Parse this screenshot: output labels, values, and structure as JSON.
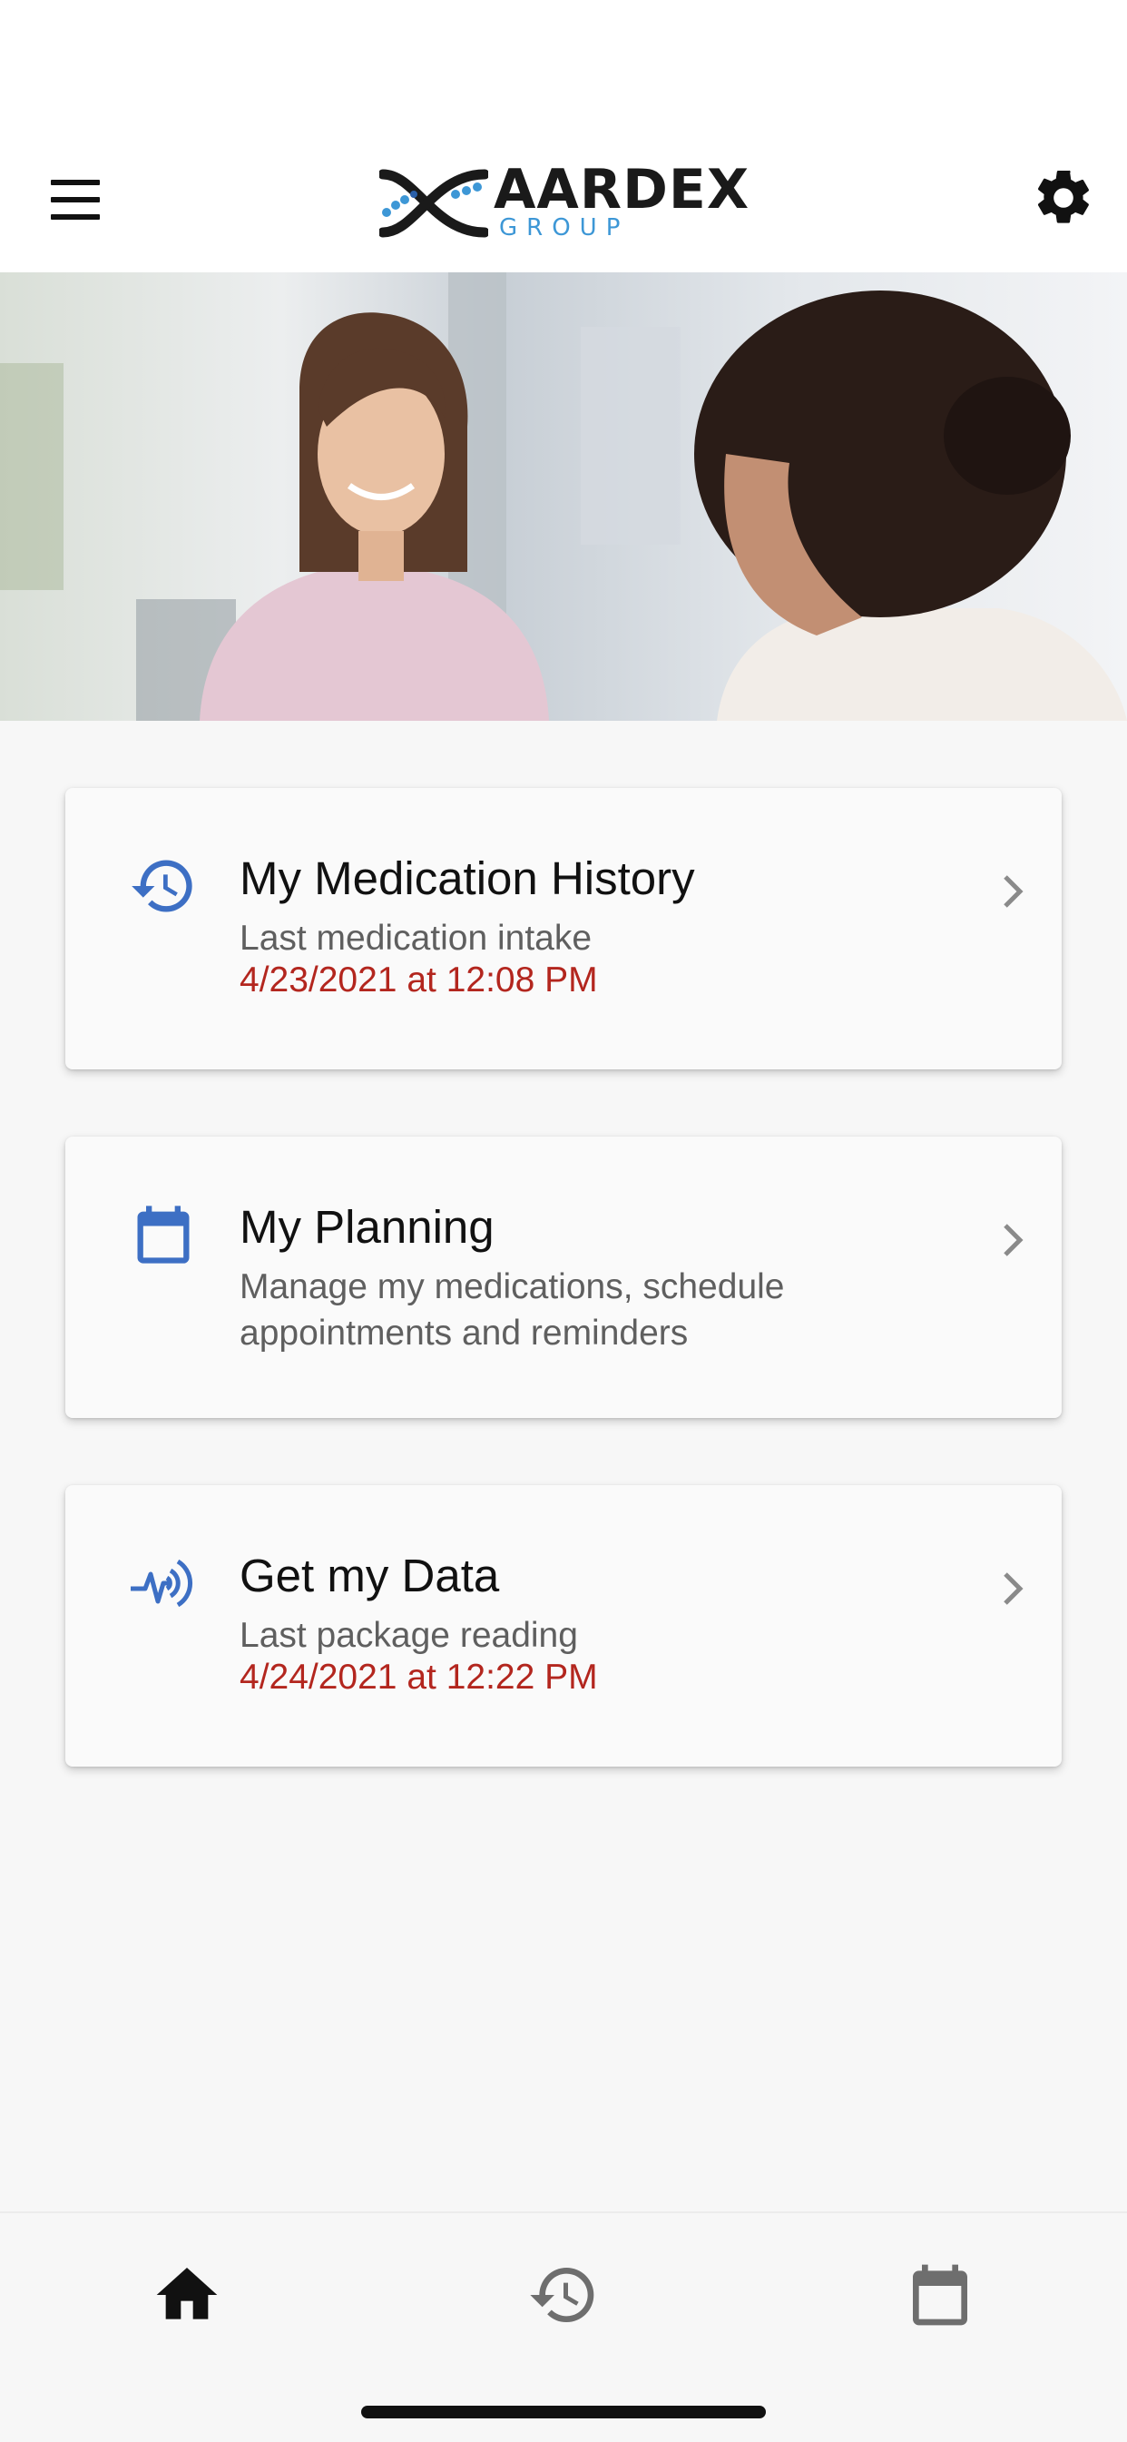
{
  "header": {
    "brand_name": "AARDEX",
    "brand_sub": "GROUP",
    "menu_icon": "hamburger-menu-icon",
    "settings_icon": "gear-icon"
  },
  "hero": {
    "image": "doctor-patient-consultation-photo"
  },
  "cards": [
    {
      "icon": "history-icon",
      "title": "My Medication History",
      "subtitle": "Last medication intake",
      "date": "4/23/2021 at 12:08 PM"
    },
    {
      "icon": "calendar-icon",
      "title": "My Planning",
      "subtitle": "Manage my medications, schedule appointments and reminders"
    },
    {
      "icon": "data-reading-icon",
      "title": "Get my Data",
      "subtitle": "Last package reading",
      "date": "4/24/2021 at 12:22 PM"
    }
  ],
  "bottom_nav": [
    {
      "icon": "home-icon",
      "selected": true
    },
    {
      "icon": "history-icon",
      "selected": false
    },
    {
      "icon": "calendar-icon",
      "selected": false
    }
  ],
  "colors": {
    "accent": "#3d6fc4",
    "date_red": "#b3261e",
    "logo_blue": "#3d97d6"
  }
}
